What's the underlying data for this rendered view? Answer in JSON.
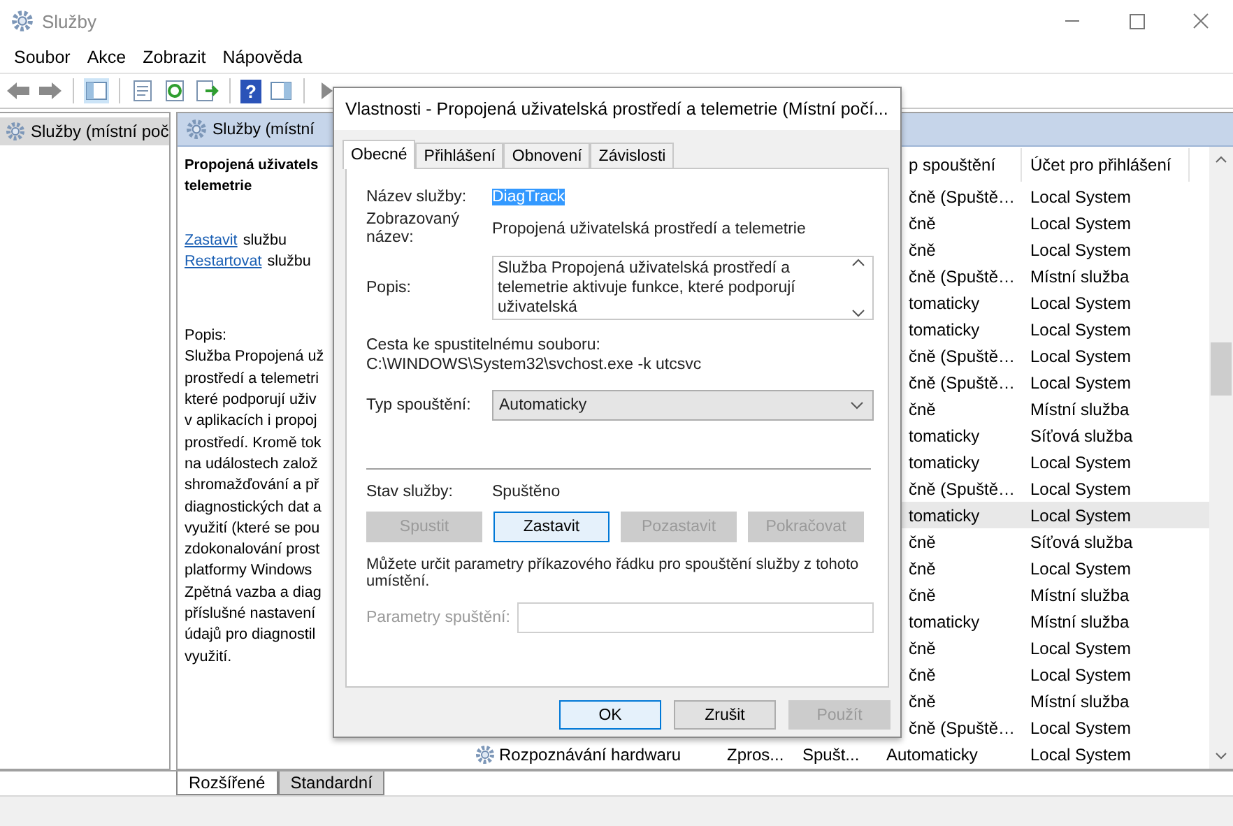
{
  "window": {
    "title": "Služby"
  },
  "menu": [
    "Soubor",
    "Akce",
    "Zobrazit",
    "Nápověda"
  ],
  "toolbar": {
    "help_glyph": "?"
  },
  "tree": {
    "items": [
      {
        "label": "Služby (místní poč",
        "selected": true
      }
    ]
  },
  "services_header": {
    "title": "Služby (místní"
  },
  "details": {
    "title_lines": [
      "Propojená uživatels",
      "telemetrie"
    ],
    "actions": [
      {
        "link": "Zastavit",
        "text": "službu"
      },
      {
        "link": "Restartovat",
        "text": "službu"
      }
    ],
    "description_label": "Popis:",
    "description_lines": [
      "Služba Propojená už",
      "prostředí a telemetri",
      "které podporují uživ",
      "v aplikacích i propoj",
      "prostředí. Kromě tok",
      "na událostech založ",
      "shromažďování a př",
      "diagnostických dat a",
      "využití (které se pou",
      "zdokonalování prost",
      "platformy Windows",
      "Zpětná vazba a diag",
      "příslušné nastavení",
      "údajů pro diagnostil",
      "využití."
    ]
  },
  "table": {
    "columns": [
      "p spouštění",
      "Účet pro přihlášení"
    ],
    "rows": [
      {
        "start_type": "čně (Spuště…",
        "account": "Local System",
        "selected": false
      },
      {
        "start_type": "čně",
        "account": "Local System",
        "selected": false
      },
      {
        "start_type": "čně",
        "account": "Local System",
        "selected": false
      },
      {
        "start_type": "čně (Spuště…",
        "account": "Místní služba",
        "selected": false
      },
      {
        "start_type": "tomaticky",
        "account": "Local System",
        "selected": false
      },
      {
        "start_type": "tomaticky",
        "account": "Local System",
        "selected": false
      },
      {
        "start_type": "čně (Spuště…",
        "account": "Local System",
        "selected": false
      },
      {
        "start_type": "čně (Spuště…",
        "account": "Local System",
        "selected": false
      },
      {
        "start_type": "čně",
        "account": "Místní služba",
        "selected": false
      },
      {
        "start_type": "tomaticky",
        "account": "Síťová služba",
        "selected": false
      },
      {
        "start_type": "tomaticky",
        "account": "Local System",
        "selected": false
      },
      {
        "start_type": "čně (Spuště…",
        "account": "Local System",
        "selected": false
      },
      {
        "start_type": "tomaticky",
        "account": "Local System",
        "selected": true
      },
      {
        "start_type": "čně",
        "account": "Síťová služba",
        "selected": false
      },
      {
        "start_type": "čně",
        "account": "Local System",
        "selected": false
      },
      {
        "start_type": "čně",
        "account": "Místní služba",
        "selected": false
      },
      {
        "start_type": "tomaticky",
        "account": "Místní služba",
        "selected": false
      },
      {
        "start_type": "čně",
        "account": "Local System",
        "selected": false
      },
      {
        "start_type": "čně",
        "account": "Local System",
        "selected": false
      },
      {
        "start_type": "čně",
        "account": "Místní služba",
        "selected": false
      },
      {
        "start_type": "čně (Spuště…",
        "account": "Local System",
        "selected": false
      },
      {
        "name": "Rozpoznávání hardwaru",
        "description": "Zpros...",
        "status": "Spušt...",
        "start_type": "Automaticky",
        "account": "Local System",
        "selected": false
      }
    ]
  },
  "view_tabs": [
    {
      "label": "Rozšířené",
      "selected": true
    },
    {
      "label": "Standardní",
      "selected": false
    }
  ],
  "dialog": {
    "title": "Vlastnosti - Propojená uživatelská prostředí a telemetrie (Místní počí...",
    "tabs": [
      {
        "label": "Obecné",
        "selected": true
      },
      {
        "label": "Přihlášení",
        "selected": false
      },
      {
        "label": "Obnovení",
        "selected": false
      },
      {
        "label": "Závislosti",
        "selected": false
      }
    ],
    "service_name_label": "Název služby:",
    "service_name": "DiagTrack",
    "display_name_label": "Zobrazovaný název:",
    "display_name": "Propojená uživatelská prostředí a telemetrie",
    "description_label": "Popis:",
    "description": "Služba Propojená uživatelská prostředí a telemetrie aktivuje funkce, které podporují uživatelská",
    "path_label": "Cesta ke spustitelnému souboru:",
    "path": "C:\\WINDOWS\\System32\\svchost.exe -k utcsvc",
    "startup_type_label": "Typ spouštění:",
    "startup_type": "Automaticky",
    "status_label": "Stav služby:",
    "status": "Spuštěno",
    "service_buttons": [
      {
        "label": "Spustit",
        "disabled": true,
        "focused": false
      },
      {
        "label": "Zastavit",
        "disabled": false,
        "focused": true
      },
      {
        "label": "Pozastavit",
        "disabled": true,
        "focused": false
      },
      {
        "label": "Pokračovat",
        "disabled": true,
        "focused": false
      }
    ],
    "hint": "Můžete určit parametry příkazového řádku pro spouštění služby z tohoto umístění.",
    "params_label": "Parametry spuštění:",
    "params_disabled": true,
    "buttons": [
      {
        "label": "OK",
        "disabled": false,
        "focused": true
      },
      {
        "label": "Zrušit",
        "disabled": false,
        "focused": false
      },
      {
        "label": "Použít",
        "disabled": true,
        "focused": false
      }
    ]
  }
}
